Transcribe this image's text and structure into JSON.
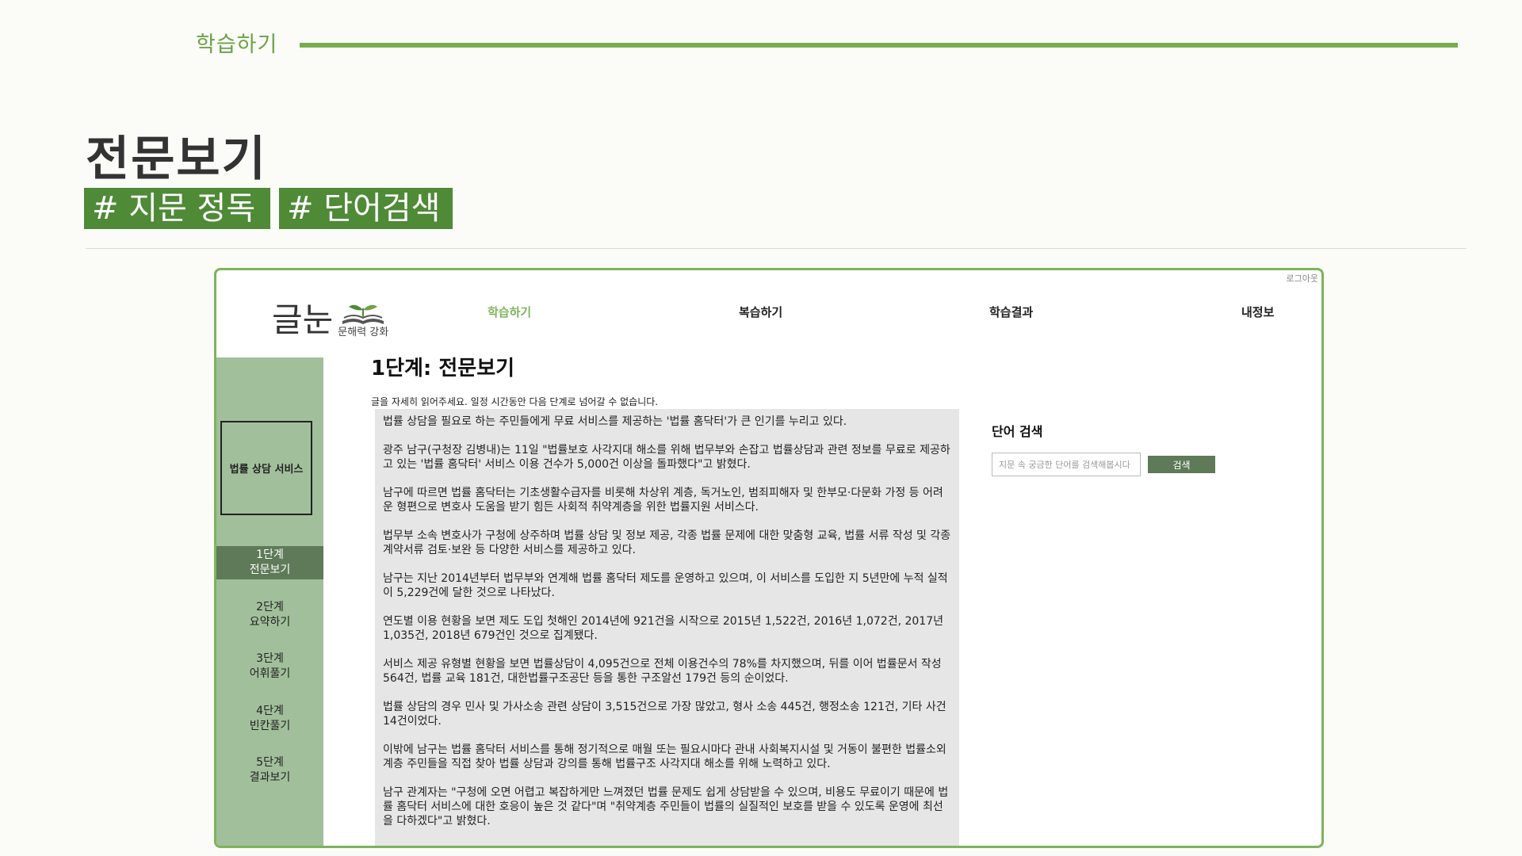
{
  "slide": {
    "section_label": "학습하기",
    "title": "전문보기",
    "tags": [
      "# 지문 정독",
      "# 단어검색"
    ]
  },
  "app": {
    "logout": "로그아웃",
    "logo": {
      "text": "글눈",
      "subtitle": "문해력 강화"
    },
    "nav": [
      {
        "label": "학습하기",
        "active": true
      },
      {
        "label": "복습하기",
        "active": false
      },
      {
        "label": "학습결과",
        "active": false
      },
      {
        "label": "내정보",
        "active": false
      }
    ],
    "sidebar": {
      "topic": "법률 상담 서비스",
      "steps": [
        {
          "line1": "1단계",
          "line2": "전문보기",
          "active": true
        },
        {
          "line1": "2단계",
          "line2": "요약하기",
          "active": false
        },
        {
          "line1": "3단계",
          "line2": "어휘풀기",
          "active": false
        },
        {
          "line1": "4단계",
          "line2": "빈칸풀기",
          "active": false
        },
        {
          "line1": "5단계",
          "line2": "결과보기",
          "active": false
        }
      ]
    },
    "heading": "1단계: 전문보기",
    "instruction": "글을 자세히 읽어주세요. 일정 시간동안 다음 단계로 넘어갈 수 없습니다.",
    "passage": [
      "법률 상담을 필요로 하는 주민들에게 무료 서비스를 제공하는 '법률 홈닥터'가 큰 인기를 누리고 있다.",
      "광주 남구(구청장 김병내)는 11일 \"법률보호 사각지대 해소를 위해 법무부와 손잡고 법률상담과 관련 정보를 무료로 제공하고 있는 '법률 홈닥터' 서비스 이용 건수가 5,000건 이상을 돌파했다\"고 밝혔다.",
      "남구에 따르면 법률 홈닥터는 기초생활수급자를 비롯해 차상위 계층, 독거노인, 범죄피해자 및 한부모·다문화 가정 등 어려운 형편으로 변호사 도움을 받기 힘든 사회적 취약계층을 위한 법률지원 서비스다.",
      "법무부 소속 변호사가 구청에 상주하며 법률 상담 및 정보 제공, 각종 법률 문제에 대한 맞춤형 교육, 법률 서류 작성 및 각종 계약서류 검토·보완 등 다양한 서비스를 제공하고 있다.",
      "남구는 지난 2014년부터 법무부와 연계해 법률 홈닥터 제도를 운영하고 있으며, 이 서비스를 도입한 지 5년만에 누적 실적이 5,229건에 달한 것으로 나타났다.",
      "연도별 이용 현황을 보면 제도 도입 첫해인 2014년에 921건을 시작으로 2015년 1,522건, 2016년 1,072건, 2017년 1,035건, 2018년 679건인 것으로 집계됐다.",
      "서비스 제공 유형별 현황을 보면 법률상담이 4,095건으로 전체 이용건수의 78%를 차지했으며, 뒤를 이어 법률문서 작성 564건, 법률 교육 181건, 대한법률구조공단 등을 통한 구조알선 179건 등의 순이었다.",
      "법률 상담의 경우 민사 및 가사소송 관련 상담이 3,515건으로 가장 많았고, 형사 소송 445건, 행정소송 121건, 기타 사건 14건이었다.",
      "이밖에 남구는 법률 홈닥터 서비스를 통해 정기적으로 매월 또는 필요시마다 관내 사회복지시설 및 거동이 불편한 법률소외 계층 주민들을 직접 찾아 법률 상담과 강의를 통해 법률구조 사각지대 해소를 위해 노력하고 있다.",
      "남구 관계자는 \"구청에 오면 어렵고 복잡하게만 느껴졌던 법률 문제도 쉽게 상담받을 수 있으며, 비용도 무료이기 때문에 법률 홈닥터 서비스에 대한 호응이 높은 것 같다\"며 \"취약계층 주민들이 법률의 실질적인 보호를 받을 수 있도록 운영에 최선을 다하겠다\"고 밝혔다."
    ],
    "search": {
      "title": "단어 검색",
      "placeholder": "지문 속 궁금한 단어를 검색해봅시다",
      "button": "검색"
    }
  },
  "colors": {
    "accent": "#78ad4e",
    "tag_bg": "#4f8a37",
    "sidebar_bg": "#a1bf9b",
    "active_step": "#5e7a58",
    "passage_bg": "#e6e6e6"
  }
}
